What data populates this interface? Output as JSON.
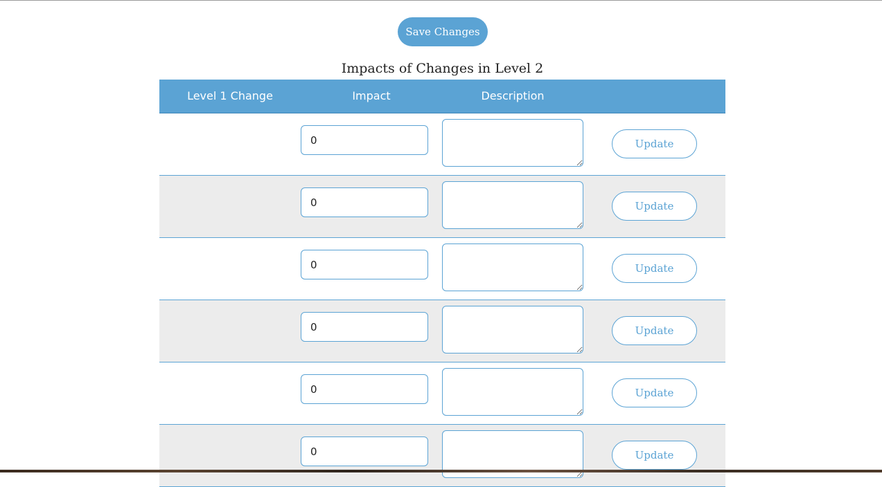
{
  "save_button": {
    "label": "Save Changes"
  },
  "section_title": "Impacts of Changes in Level 2",
  "table": {
    "headers": [
      "Level 1 Change",
      "Impact",
      "Description",
      ""
    ],
    "rows": [
      {
        "level1_change": "",
        "impact": "0",
        "description": "",
        "action": "Update"
      },
      {
        "level1_change": "",
        "impact": "0",
        "description": "",
        "action": "Update"
      },
      {
        "level1_change": "",
        "impact": "0",
        "description": "",
        "action": "Update"
      },
      {
        "level1_change": "",
        "impact": "0",
        "description": "",
        "action": "Update"
      },
      {
        "level1_change": "",
        "impact": "0",
        "description": "",
        "action": "Update"
      },
      {
        "level1_change": "",
        "impact": "0",
        "description": "",
        "action": "Update"
      }
    ]
  },
  "colors": {
    "accent": "#5ba3d4",
    "row_alt": "#ececec",
    "text": "#222222"
  }
}
